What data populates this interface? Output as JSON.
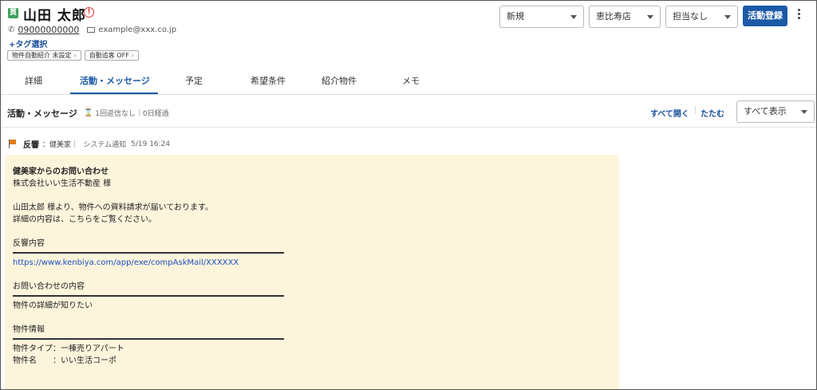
{
  "customer": {
    "badge": "買",
    "name": "山田 太郎",
    "alert": "!",
    "phone": "09000000000",
    "email": "example@xxx.co.jp",
    "tag_select": "+タグ選択",
    "chips": [
      {
        "label": "物件自動紹介 未設定"
      },
      {
        "label": "自動追客 OFF"
      }
    ]
  },
  "toolbar": {
    "status": "新規",
    "store": "恵比寿店",
    "assignee": "担当なし",
    "register_label": "活動登録"
  },
  "tabs": [
    {
      "label": "詳細"
    },
    {
      "label": "活動・メッセージ"
    },
    {
      "label": "予定"
    },
    {
      "label": "希望条件"
    },
    {
      "label": "紹介物件"
    },
    {
      "label": "メモ"
    }
  ],
  "section": {
    "title": "活動・メッセージ",
    "no_reply": "1回返信なし",
    "elapsed": "0日経過",
    "expand_all": "すべて開く",
    "collapse": "たたむ",
    "filter": "すべて表示"
  },
  "entry": {
    "type": "反響",
    "source": "：健美家",
    "meta": "システム通知",
    "time": "5/19 16:24",
    "message": {
      "title": "健美家からのお問い合わせ",
      "recipient": "株式会社いい生活不動産 様",
      "line1": "山田太郎 様より、物件への資料請求が届いております。",
      "line2": "詳細の内容は、こちらをご覧ください。",
      "heading1": "反響内容",
      "url": "https://www.kenbiya.com/app/exe/compAskMail/XXXXXX",
      "heading2": "お問い合わせの内容",
      "inquiry": "物件の詳細が知りたい",
      "heading3": "物件情報",
      "prop_type": "物件タイプ：一棟売りアパート",
      "prop_name": "物件名　　：いい生活コーポ"
    }
  },
  "colors": {
    "accent": "#1c5aa8",
    "message_bg": "#fdf4dc",
    "flag": "#e07b1a",
    "badge": "#3aa35a"
  }
}
